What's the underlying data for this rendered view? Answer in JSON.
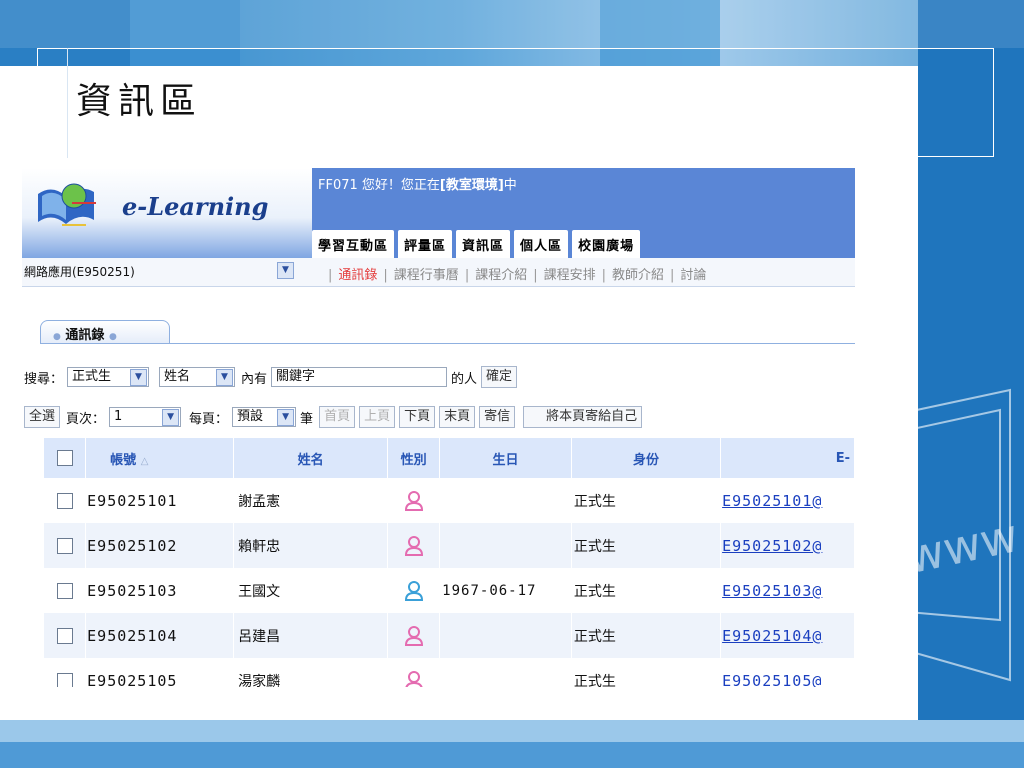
{
  "slide": {
    "title": "資訊區"
  },
  "app": {
    "logo_text": "e-Learning",
    "greeting_prefix": "FF071 您好！您正在",
    "greeting_place": "[教室環境]",
    "greeting_suffix": "中",
    "main_tabs": [
      "學習互動區",
      "評量區",
      "資訊區",
      "個人區",
      "校園廣場"
    ],
    "course": {
      "selected": "網路應用(E950251)"
    },
    "sub_nav": [
      "通訊錄",
      "課程行事曆",
      "課程介紹",
      "課程安排",
      "教師介紹",
      "討論"
    ],
    "section_tab": "通訊錄",
    "search": {
      "label": "搜尋：",
      "role_value": "正式生",
      "field_value": "姓名",
      "contains": "內有",
      "keyword_value": "關鍵字",
      "of_people": "的人",
      "confirm": "確定"
    },
    "paging": {
      "select_all": "全選",
      "page_label": "頁次：",
      "page_value": "1",
      "per_page_label": "每頁：",
      "per_page_value": "預設",
      "unit": "筆",
      "first": "首頁",
      "prev": "上頁",
      "next": "下頁",
      "last": "末頁",
      "send_mail": "寄信",
      "send_self": "將本頁寄給自己"
    },
    "table": {
      "headers": [
        "帳號",
        "姓名",
        "性別",
        "生日",
        "身份",
        "E-"
      ],
      "rows": [
        {
          "account": "E95025101",
          "name": "謝孟憲",
          "gender": "female",
          "birthday": "",
          "role": "正式生",
          "email": "E95025101@"
        },
        {
          "account": "E95025102",
          "name": "賴軒忠",
          "gender": "female",
          "birthday": "",
          "role": "正式生",
          "email": "E95025102@"
        },
        {
          "account": "E95025103",
          "name": "王國文",
          "gender": "male",
          "birthday": "1967-06-17",
          "role": "正式生",
          "email": "E95025103@"
        },
        {
          "account": "E95025104",
          "name": "呂建昌",
          "gender": "female",
          "birthday": "",
          "role": "正式生",
          "email": "E95025104@"
        },
        {
          "account": "E95025105",
          "name": "湯家麟",
          "gender": "female",
          "birthday": "",
          "role": "正式生",
          "email": "E95025105@"
        }
      ]
    },
    "colors": {
      "header_blue": "#5a86d6",
      "female": "#e46bb0",
      "male": "#3aa0d8",
      "link": "#1a3fc0"
    }
  }
}
